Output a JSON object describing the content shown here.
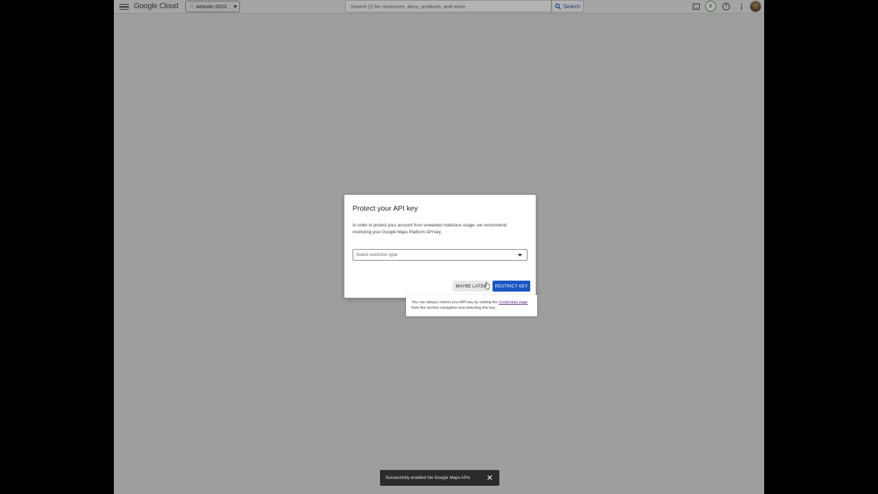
{
  "header": {
    "logo_text": "Google Cloud",
    "project_name": "website-2023",
    "search_placeholder": "Search (/) for resources, docs, products, and more",
    "search_button_label": "Search",
    "notification_count": "6"
  },
  "dialog": {
    "title": "Protect your API key",
    "body": "In order to protect your account from unwanted malicious usage, we recommend restricting your Google Maps Platform API key.",
    "select_placeholder": "Select restriction type",
    "maybe_later_label": "MAYBE LATER",
    "restrict_key_label": "RESTRICT KEY"
  },
  "tooltip": {
    "text_before": "You can always restrict your API key by visiting the ",
    "link_text": "Credentials page",
    "text_after": " from the section navigation and selecting this key"
  },
  "snackbar": {
    "message": "Successfully enabled the Google Maps APIs"
  },
  "icons": [
    "menu-icon",
    "project-icon",
    "search-icon",
    "terminal-icon",
    "help-icon",
    "more-vert-icon",
    "close-icon"
  ],
  "colors": {
    "primary_button": "#1a56c4",
    "link": "#5a2f8a",
    "snackbar_bg": "#2b2b2b",
    "overlay_bg": "#9e9e9e"
  }
}
